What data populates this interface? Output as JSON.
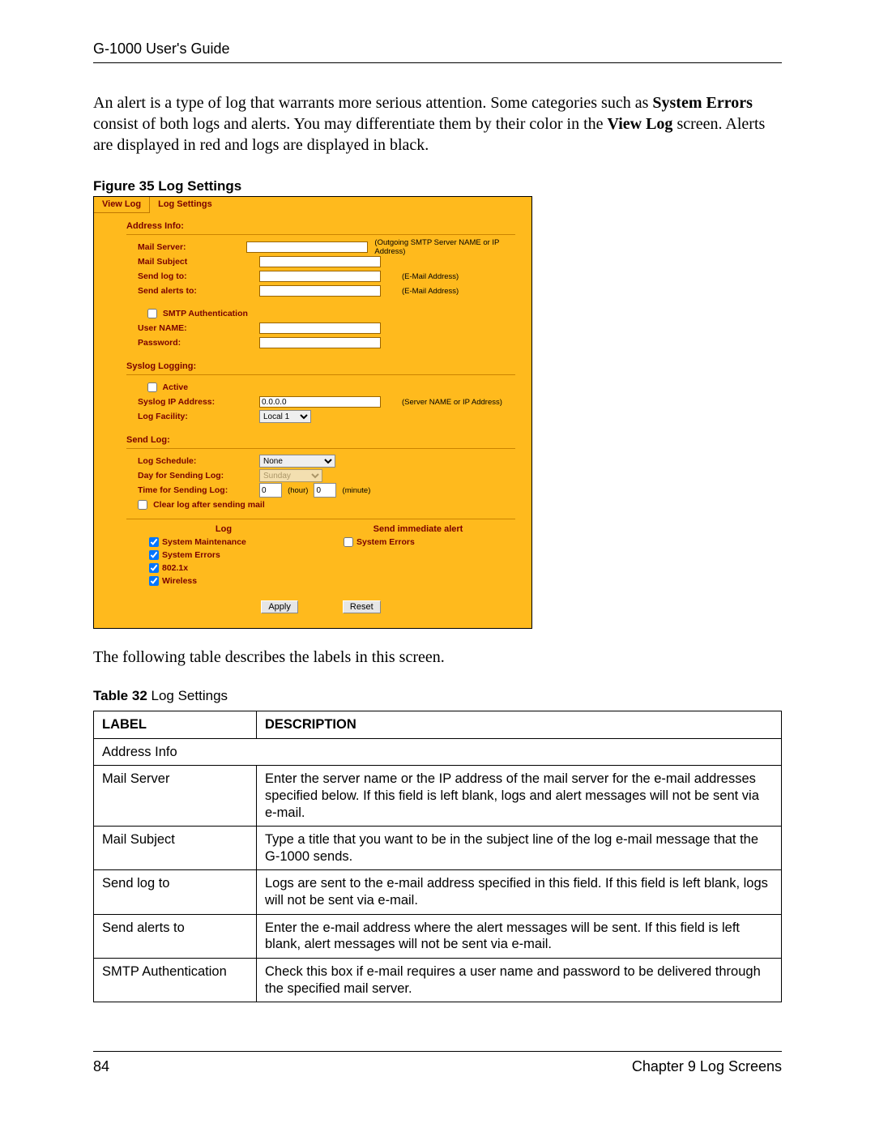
{
  "header": {
    "title": "G-1000 User's Guide"
  },
  "intro": {
    "t1": "An alert is a type of log that warrants more serious attention. Some categories such as ",
    "b1": "System Errors",
    "t2": " consist of both logs and alerts. You may differentiate them by their color in the ",
    "b2": "View Log",
    "t3": " screen. Alerts are displayed in red and logs are displayed in black."
  },
  "fig_caption": "Figure 35   Log Settings",
  "shot": {
    "tabs": {
      "view_log": "View Log",
      "log_settings": "Log Settings"
    },
    "sec_address": "Address Info:",
    "mail_server": "Mail Server:",
    "mail_server_hint": "(Outgoing SMTP Server NAME or IP Address)",
    "mail_subject": "Mail Subject",
    "send_log_to": "Send log to:",
    "send_log_hint": "(E-Mail Address)",
    "send_alerts_to": "Send alerts to:",
    "send_alerts_hint": "(E-Mail Address)",
    "smtp_auth": "SMTP Authentication",
    "user_name": "User NAME:",
    "password": "Password:",
    "sec_syslog": "Syslog Logging:",
    "active": "Active",
    "syslog_ip": "Syslog IP Address:",
    "syslog_ip_val": "0.0.0.0",
    "syslog_ip_hint": "(Server NAME or IP Address)",
    "log_facility": "Log Facility:",
    "log_facility_val": "Local 1",
    "sec_sendlog": "Send Log:",
    "log_schedule": "Log Schedule:",
    "log_schedule_val": "None",
    "day_sending": "Day for Sending Log:",
    "day_sending_val": "Sunday",
    "time_sending": "Time for Sending Log:",
    "time_hour": "0",
    "time_hour_lbl": "(hour)",
    "time_min": "0",
    "time_min_lbl": "(minute)",
    "clear_log": "Clear log after sending mail",
    "col_log": "Log",
    "col_alert": "Send immediate alert",
    "log_opts": {
      "sys_maint": "System Maintenance",
      "sys_err": "System Errors",
      "dot1x": "802.1x",
      "wireless": "Wireless"
    },
    "alert_opts": {
      "sys_err": "System Errors"
    },
    "btn_apply": "Apply",
    "btn_reset": "Reset"
  },
  "after_text": "The following table describes the labels in this screen.",
  "tbl_caption_bold": "Table 32",
  "tbl_caption_rest": "   Log Settings",
  "table": {
    "hdr_label": "LABEL",
    "hdr_desc": "DESCRIPTION",
    "rows": [
      {
        "label": "Address Info",
        "desc": ""
      },
      {
        "label": "Mail Server",
        "desc": "Enter the server name or the IP address of the mail server for the e-mail addresses specified below. If this field is left blank, logs and alert messages will not be sent via e-mail."
      },
      {
        "label": "Mail Subject",
        "desc": "Type a title that you want to be in the subject line of the log e-mail message that the G-1000 sends."
      },
      {
        "label": "Send log to",
        "desc": "Logs are sent to the e-mail address specified in this field. If this field is left blank, logs will not be sent via e-mail."
      },
      {
        "label": "Send alerts to",
        "desc": "Enter the e-mail address where the alert messages will be sent. If this field is left blank, alert messages will not be sent via e-mail."
      },
      {
        "label": "SMTP Authentication",
        "desc": "Check this box if e-mail requires a user name and password to be delivered through the specified mail server."
      }
    ]
  },
  "footer": {
    "page": "84",
    "chapter": "Chapter 9 Log Screens"
  }
}
